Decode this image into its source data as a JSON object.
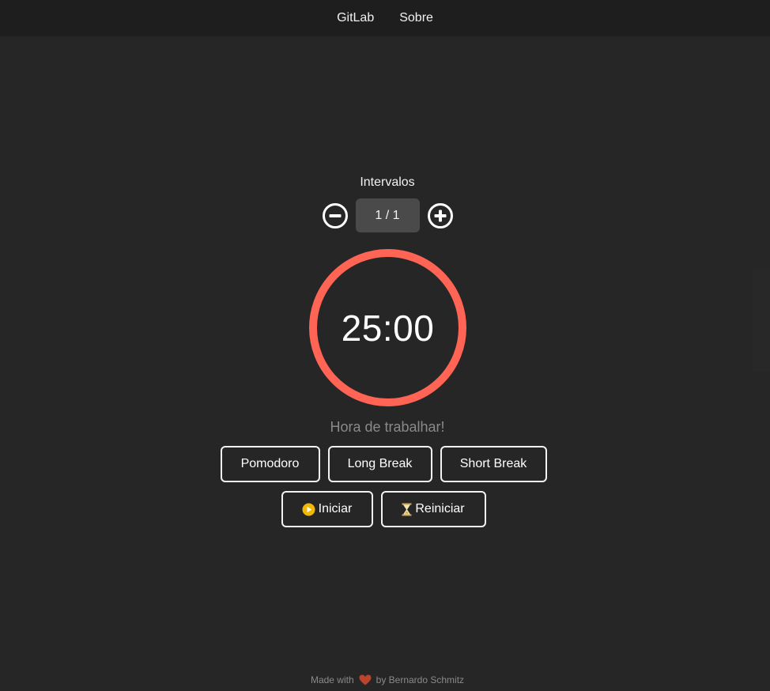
{
  "nav": {
    "items": [
      "GitLab",
      "Sobre"
    ]
  },
  "intervals": {
    "label": "Intervalos",
    "value": "1 / 1",
    "decrement_icon": "minus-circle-icon",
    "increment_icon": "plus-circle-icon"
  },
  "timer": {
    "time": "25:00",
    "ring_color": "#ff6454",
    "progress": 1.0
  },
  "status": "Hora de trabalhar!",
  "modes": [
    "Pomodoro",
    "Long Break",
    "Short Break"
  ],
  "controls": {
    "start_label": "Iniciar",
    "start_icon": "play-icon",
    "start_icon_color": "#f5b800",
    "reset_label": "Reiniciar",
    "reset_icon": "hourglass-icon"
  },
  "footer": {
    "prefix": "Made with",
    "heart_icon": "heart-icon",
    "heart_color": "#b8452c",
    "suffix": "by Bernardo Schmitz"
  }
}
